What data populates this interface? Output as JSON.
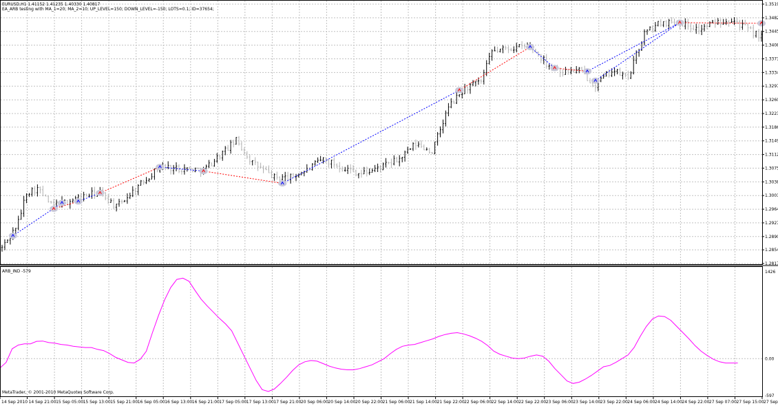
{
  "header": {
    "symbol_line": "EURUSD,H1  1.41152 1.41235 1.40330 1.40817",
    "ea_line": "EA_ARB testing with MA_1=20; MA_2=10; UP_LEVEL=150; DOWN_LEVEL=-150; LOTS=0.1; ID=37654;"
  },
  "indicator": {
    "label": "ARB_IND -579"
  },
  "footer": {
    "copyright": "MetaTrader, © 2001-2010 MetaQuotes Software Corp."
  },
  "colors": {
    "bull_bar": "#000000",
    "bear_bar": "#b0b0b0",
    "buy_trade": "#0000ff",
    "sell_trade": "#ff0000",
    "indicator_line": "#ff00ff",
    "grid": "#c0c0c0",
    "marker": "#c8c8d8"
  },
  "chart_data": [
    {
      "type": "candlestick",
      "title": "EURUSD,H1",
      "grid": true,
      "ylim": [
        1.2817,
        1.3519
      ],
      "y_ticks": [
        "1.35190",
        "1.34820",
        "1.34450",
        "1.34080",
        "1.33710",
        "1.33340",
        "1.32970",
        "1.32600",
        "1.32230",
        "1.31860",
        "1.31490",
        "1.31120",
        "1.30750",
        "1.30380",
        "1.30010",
        "1.29640",
        "1.29270",
        "1.28900",
        "1.28540",
        "1.28170"
      ],
      "x_ticks": [
        "14 Sep 2010",
        "14 Sep 21:00",
        "15 Sep 05:00",
        "15 Sep 13:00",
        "15 Sep 21:00",
        "16 Sep 05:00",
        "16 Sep 13:00",
        "16 Sep 21:00",
        "17 Sep 05:00",
        "17 Sep 13:00",
        "17 Sep 21:00",
        "20 Sep 06:00",
        "20 Sep 14:00",
        "20 Sep 22:00",
        "21 Sep 06:00",
        "21 Sep 14:00",
        "21 Sep 22:00",
        "22 Sep 06:00",
        "22 Sep 14:00",
        "22 Sep 22:00",
        "23 Sep 06:00",
        "23 Sep 14:00",
        "23 Sep 22:00",
        "24 Sep 06:00",
        "24 Sep 14:00",
        "24 Sep 22:00",
        "27 Sep 07:00",
        "27 Sep 15:00",
        "27 Sep 23:00"
      ],
      "trades": [
        {
          "direction": "buy",
          "from": [
            4,
            1.2892
          ],
          "to": [
            22,
            1.2981
          ]
        },
        {
          "direction": "sell",
          "from": [
            19,
            1.2965
          ],
          "to": [
            28,
            1.2985
          ]
        },
        {
          "direction": "buy",
          "from": [
            28,
            1.2985
          ],
          "to": [
            36,
            1.3008
          ]
        },
        {
          "direction": "sell",
          "from": [
            36,
            1.3008
          ],
          "to": [
            58,
            1.3078
          ]
        },
        {
          "direction": "buy",
          "from": [
            58,
            1.3078
          ],
          "to": [
            74,
            1.3067
          ]
        },
        {
          "direction": "sell",
          "from": [
            74,
            1.3067
          ],
          "to": [
            103,
            1.3034
          ]
        },
        {
          "direction": "buy",
          "from": [
            103,
            1.3034
          ],
          "to": [
            168,
            1.3286
          ]
        },
        {
          "direction": "sell",
          "from": [
            168,
            1.3286
          ],
          "to": [
            194,
            1.3403
          ]
        },
        {
          "direction": "buy",
          "from": [
            194,
            1.3403
          ],
          "to": [
            203,
            1.3346
          ]
        },
        {
          "direction": "sell",
          "from": [
            203,
            1.3346
          ],
          "to": [
            215,
            1.3337
          ]
        },
        {
          "direction": "buy",
          "from": [
            215,
            1.3337
          ],
          "to": [
            249,
            1.3469
          ]
        },
        {
          "direction": "buy",
          "from": [
            218,
            1.3312
          ],
          "to": [
            249,
            1.3469
          ]
        },
        {
          "direction": "sell",
          "from": [
            249,
            1.3469
          ],
          "to": [
            279,
            1.3467
          ]
        }
      ]
    },
    {
      "type": "line",
      "title": "ARB_IND -579",
      "grid": true,
      "ylim": [
        -597,
        1426
      ],
      "y_ticks": [
        "1426",
        "0.00",
        "-597"
      ],
      "series": [
        {
          "values": [
            [
              0,
              -150
            ],
            [
              8,
              -60
            ],
            [
              16,
              160
            ],
            [
              24,
              220
            ],
            [
              32,
              240
            ],
            [
              40,
              240
            ],
            [
              48,
              280
            ],
            [
              56,
              285
            ],
            [
              64,
              260
            ],
            [
              72,
              250
            ],
            [
              80,
              230
            ],
            [
              88,
              220
            ],
            [
              96,
              200
            ],
            [
              104,
              190
            ],
            [
              112,
              180
            ],
            [
              120,
              180
            ],
            [
              128,
              150
            ],
            [
              136,
              130
            ],
            [
              144,
              80
            ],
            [
              152,
              20
            ],
            [
              160,
              -20
            ],
            [
              168,
              -60
            ],
            [
              176,
              -70
            ],
            [
              184,
              -10
            ],
            [
              192,
              120
            ],
            [
              200,
              420
            ],
            [
              208,
              700
            ],
            [
              216,
              950
            ],
            [
              224,
              1150
            ],
            [
              232,
              1280
            ],
            [
              240,
              1300
            ],
            [
              248,
              1250
            ],
            [
              256,
              1100
            ],
            [
              264,
              960
            ],
            [
              272,
              850
            ],
            [
              280,
              750
            ],
            [
              288,
              650
            ],
            [
              296,
              560
            ],
            [
              304,
              450
            ],
            [
              312,
              250
            ],
            [
              320,
              50
            ],
            [
              328,
              -150
            ],
            [
              336,
              -350
            ],
            [
              344,
              -500
            ],
            [
              352,
              -530
            ],
            [
              360,
              -490
            ],
            [
              368,
              -400
            ],
            [
              376,
              -300
            ],
            [
              384,
              -190
            ],
            [
              392,
              -100
            ],
            [
              400,
              -50
            ],
            [
              408,
              -30
            ],
            [
              416,
              -40
            ],
            [
              424,
              -80
            ],
            [
              432,
              -120
            ],
            [
              440,
              -150
            ],
            [
              448,
              -170
            ],
            [
              456,
              -180
            ],
            [
              464,
              -180
            ],
            [
              472,
              -160
            ],
            [
              480,
              -130
            ],
            [
              488,
              -100
            ],
            [
              496,
              -50
            ],
            [
              504,
              0
            ],
            [
              512,
              80
            ],
            [
              520,
              150
            ],
            [
              528,
              200
            ],
            [
              536,
              220
            ],
            [
              544,
              230
            ],
            [
              552,
              260
            ],
            [
              560,
              290
            ],
            [
              568,
              320
            ],
            [
              576,
              360
            ],
            [
              584,
              390
            ],
            [
              592,
              410
            ],
            [
              600,
              420
            ],
            [
              608,
              400
            ],
            [
              616,
              370
            ],
            [
              624,
              330
            ],
            [
              632,
              280
            ],
            [
              640,
              210
            ],
            [
              648,
              120
            ],
            [
              656,
              70
            ],
            [
              664,
              40
            ],
            [
              672,
              10
            ],
            [
              680,
              0
            ],
            [
              688,
              10
            ],
            [
              696,
              40
            ],
            [
              704,
              60
            ],
            [
              712,
              40
            ],
            [
              720,
              -40
            ],
            [
              728,
              -160
            ],
            [
              736,
              -260
            ],
            [
              744,
              -360
            ],
            [
              752,
              -400
            ],
            [
              760,
              -380
            ],
            [
              768,
              -330
            ],
            [
              776,
              -270
            ],
            [
              784,
              -200
            ],
            [
              792,
              -130
            ],
            [
              800,
              -110
            ],
            [
              808,
              -60
            ],
            [
              816,
              0
            ],
            [
              824,
              60
            ],
            [
              832,
              180
            ],
            [
              840,
              360
            ],
            [
              848,
              520
            ],
            [
              856,
              640
            ],
            [
              864,
              690
            ],
            [
              872,
              680
            ],
            [
              880,
              620
            ],
            [
              888,
              520
            ],
            [
              896,
              420
            ],
            [
              904,
              320
            ],
            [
              912,
              210
            ],
            [
              920,
              120
            ],
            [
              928,
              50
            ],
            [
              936,
              -10
            ],
            [
              944,
              -50
            ],
            [
              952,
              -70
            ],
            [
              960,
              -70
            ],
            [
              968,
              -70
            ]
          ]
        }
      ]
    }
  ]
}
